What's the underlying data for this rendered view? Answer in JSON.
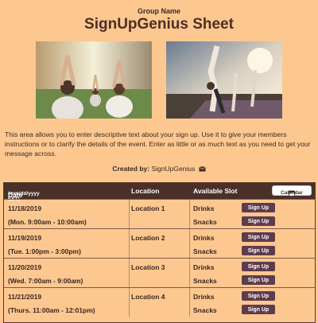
{
  "header": {
    "group_name": "Group Name",
    "title": "SignUpGenius Sheet"
  },
  "description": "This area allows you to enter descriptive text about your sign up. Use it to give your members instructions or to clarify the details of the event. Enter as little or as much text as you need to get your message across.",
  "created_by": {
    "label": "Created by:",
    "name": "SignUpGenius"
  },
  "table": {
    "col_date": "Date",
    "col_date_format": "(mm/dd/yyyy EST)",
    "col_location": "Location",
    "col_slot": "Available Slot",
    "calendar_label": "Calendar",
    "rows": [
      {
        "date": "11/18/2019",
        "time": "(Mon. 9:00am - 10:00am)",
        "location": "Location 1",
        "slot1": "Drinks",
        "slot2": "Snacks",
        "btn1": "Sign Up",
        "btn2": "Sign Up"
      },
      {
        "date": "11/19/2019",
        "time": "(Tue. 1:00pm - 3:00pm)",
        "location": "Location 2",
        "slot1": "Drinks",
        "slot2": "Snacks",
        "btn1": "Sign Up",
        "btn2": "Sign Up"
      },
      {
        "date": "11/20/2019",
        "time": "(Wed. 7:00am - 9:00am)",
        "location": "Location 3",
        "slot1": "Drinks",
        "slot2": "Snacks",
        "btn1": "Sign Up",
        "btn2": "Sign Up"
      },
      {
        "date": "11/21/2019",
        "time": "(Thurs. 11:00am - 12:01pm)",
        "location": "Location 4",
        "slot1": "Drinks",
        "slot2": "Snacks",
        "btn1": "Sign Up",
        "btn2": "Sign Up"
      }
    ]
  },
  "colors": {
    "background": "#fcc890",
    "header_bar": "#4a3028",
    "button": "#5e3c4c",
    "title": "#4e2e26"
  },
  "icons": {
    "mail": "envelope-icon",
    "calendar": "calendar-icon"
  }
}
